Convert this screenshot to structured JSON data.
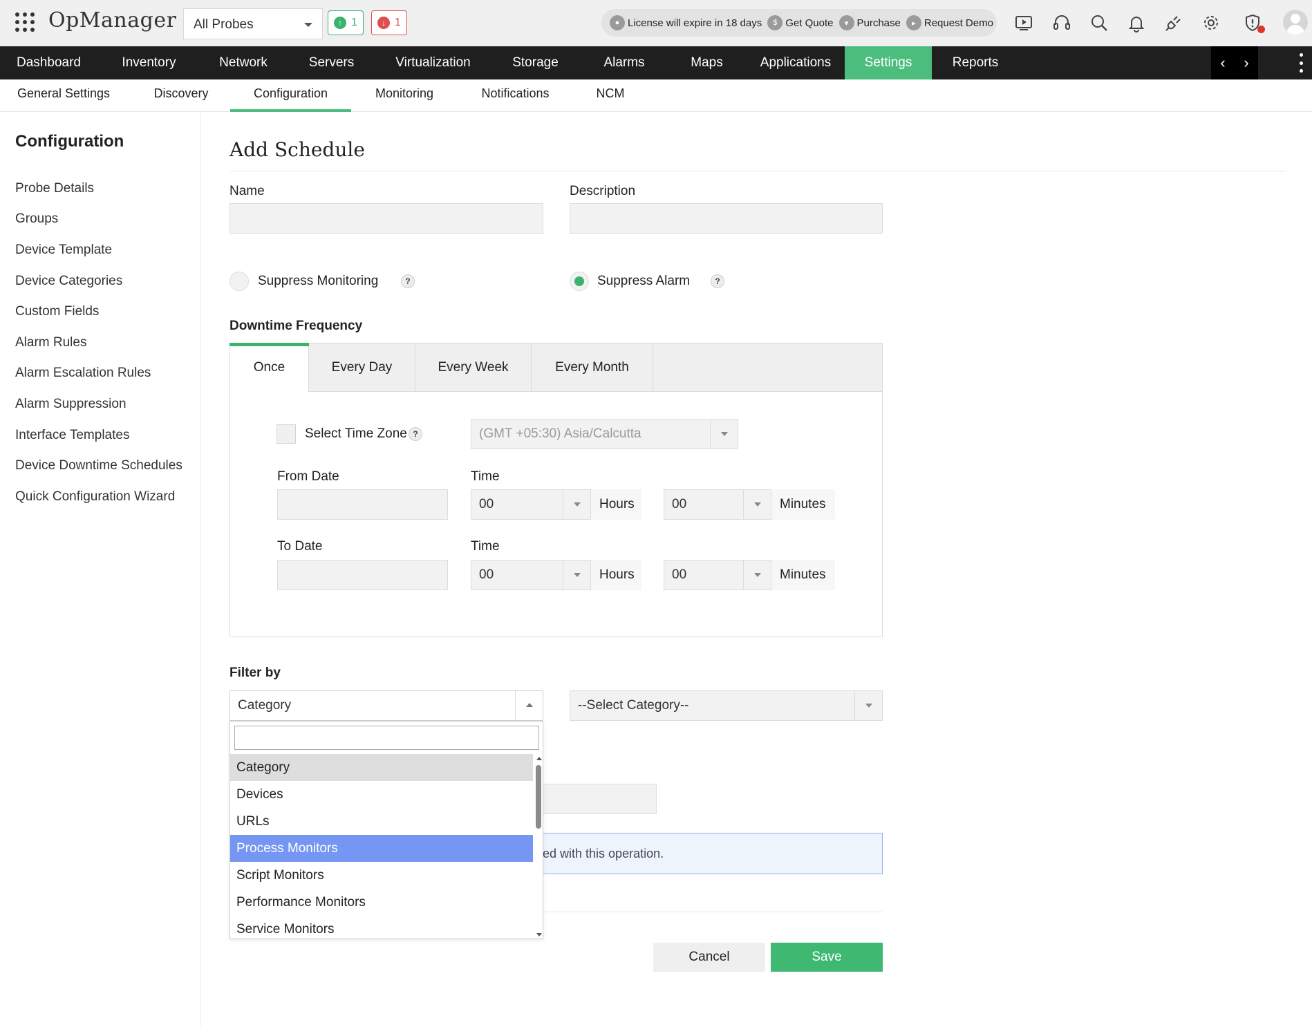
{
  "app": {
    "name": "OpManager"
  },
  "probe_selector": {
    "value": "All Probes"
  },
  "status_badges": {
    "up_count": "1",
    "down_count": "1"
  },
  "license_bar": {
    "license_text": "License will expire in 18 days",
    "get_quote": "Get Quote",
    "purchase": "Purchase",
    "request_demo": "Request Demo"
  },
  "main_nav": {
    "items": [
      "Dashboard",
      "Inventory",
      "Network",
      "Servers",
      "Virtualization",
      "Storage",
      "Alarms",
      "Maps",
      "Applications",
      "Settings",
      "Reports"
    ],
    "active": "Settings"
  },
  "sub_nav": {
    "items": [
      "General Settings",
      "Discovery",
      "Configuration",
      "Monitoring",
      "Notifications",
      "NCM"
    ],
    "active": "Configuration"
  },
  "sidebar": {
    "title": "Configuration",
    "links": [
      "Probe Details",
      "Groups",
      "Device Template",
      "Device Categories",
      "Custom Fields",
      "Alarm Rules",
      "Alarm Escalation Rules",
      "Alarm Suppression",
      "Interface Templates",
      "Device Downtime Schedules",
      "Quick Configuration Wizard"
    ]
  },
  "form": {
    "title": "Add Schedule",
    "name_label": "Name",
    "name_value": "",
    "description_label": "Description",
    "description_value": "",
    "suppress_monitoring_label": "Suppress Monitoring",
    "suppress_monitoring_selected": false,
    "suppress_alarm_label": "Suppress Alarm",
    "suppress_alarm_selected": true,
    "help_glyph": "?",
    "downtime_frequency_label": "Downtime Frequency",
    "frequency_tabs": [
      "Once",
      "Every Day",
      "Every Week",
      "Every Month"
    ],
    "active_tab": "Once",
    "select_time_zone_label": "Select Time Zone",
    "time_zone_value": "(GMT +05:30) Asia/Calcutta",
    "from_date_label": "From Date",
    "to_date_label": "To Date",
    "time_label": "Time",
    "from_hours": "00",
    "from_minutes": "00",
    "to_hours": "00",
    "to_minutes": "00",
    "hours_unit": "Hours",
    "minutes_unit": "Minutes",
    "filter_by_label": "Filter by",
    "filter_type_value": "Category",
    "filter_value_placeholder": "--Select Category--",
    "info_text_visible": "ed with this operation.",
    "cancel_label": "Cancel",
    "save_label": "Save"
  },
  "filter_dropdown": {
    "search_value": "",
    "options": [
      "Category",
      "Devices",
      "URLs",
      "Process Monitors",
      "Script Monitors",
      "Performance Monitors",
      "Service Monitors"
    ],
    "hovered": "Category",
    "highlighted": "Process Monitors"
  },
  "colors": {
    "accent_green": "#4dbd7e",
    "nav_bg": "#1f1f1f",
    "dropdown_highlight": "#7596f2",
    "info_border": "#8db1e6",
    "alert_red": "#e14d4d"
  },
  "icons": [
    "apps-grid-icon",
    "up-arrow-icon",
    "down-arrow-icon",
    "license-icon",
    "quote-icon",
    "cart-icon",
    "demo-icon",
    "video-icon",
    "headset-icon",
    "search-icon",
    "bell-icon",
    "plug-icon",
    "gear-icon",
    "shield-alert-icon",
    "avatar-icon"
  ]
}
